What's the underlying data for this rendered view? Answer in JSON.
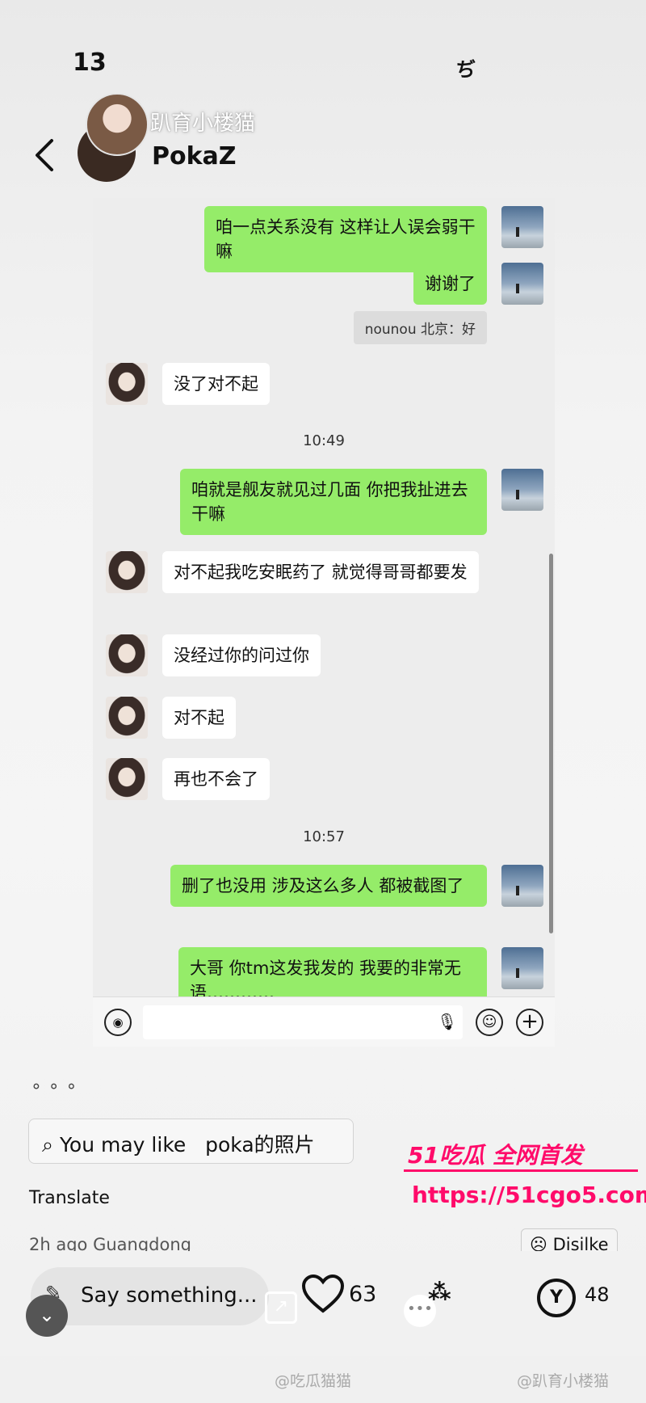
{
  "status_bar": {
    "time": "13",
    "right_text": "ぢ"
  },
  "header": {
    "sub_title": "趴育小楼猫",
    "name": "PokaZ"
  },
  "chat": {
    "messages": [
      {
        "side": "me",
        "text": "咱一点关系没有 这样让人误会弱干嘛"
      },
      {
        "side": "me",
        "text": "谢谢了"
      },
      {
        "notice": "nounou 北京：好"
      },
      {
        "side": "them",
        "text": "没了对不起"
      },
      {
        "time": "10:49"
      },
      {
        "side": "me",
        "text": "咱就是舰友就见过几面 你把我扯进去干嘛"
      },
      {
        "side": "them",
        "text": "对不起我吃安眠药了 就觉得哥哥都要发"
      },
      {
        "side": "them",
        "text": "没经过你的问过你"
      },
      {
        "side": "them",
        "text": "对不起"
      },
      {
        "side": "them",
        "text": "再也不会了"
      },
      {
        "time": "10:57"
      },
      {
        "side": "me",
        "text": "删了也没用 涉及这么多人 都被截图了"
      },
      {
        "side": "me",
        "text": "大哥 你tm这发我发的 我要的非常无语…………"
      }
    ]
  },
  "post": {
    "dots": "∘∘∘",
    "you_may_like_label": "You may like",
    "you_may_like_query": "poka的照片",
    "translate": "Translate",
    "meta": "2h ago Guangdong",
    "dislike": "Disilke"
  },
  "watermark": {
    "line1": "51吃瓜 全网首发",
    "line2": "https://51cgo5.com"
  },
  "bottom_bar": {
    "say_placeholder": "Say something...",
    "likes": "63",
    "favorites": "48"
  },
  "footer": {
    "left": "@吃瓜猫猫",
    "right": "@趴育小楼猫"
  },
  "colors": {
    "my_bubble": "#95ec69",
    "their_bubble": "#ffffff",
    "watermark": "#ff0b6a"
  }
}
